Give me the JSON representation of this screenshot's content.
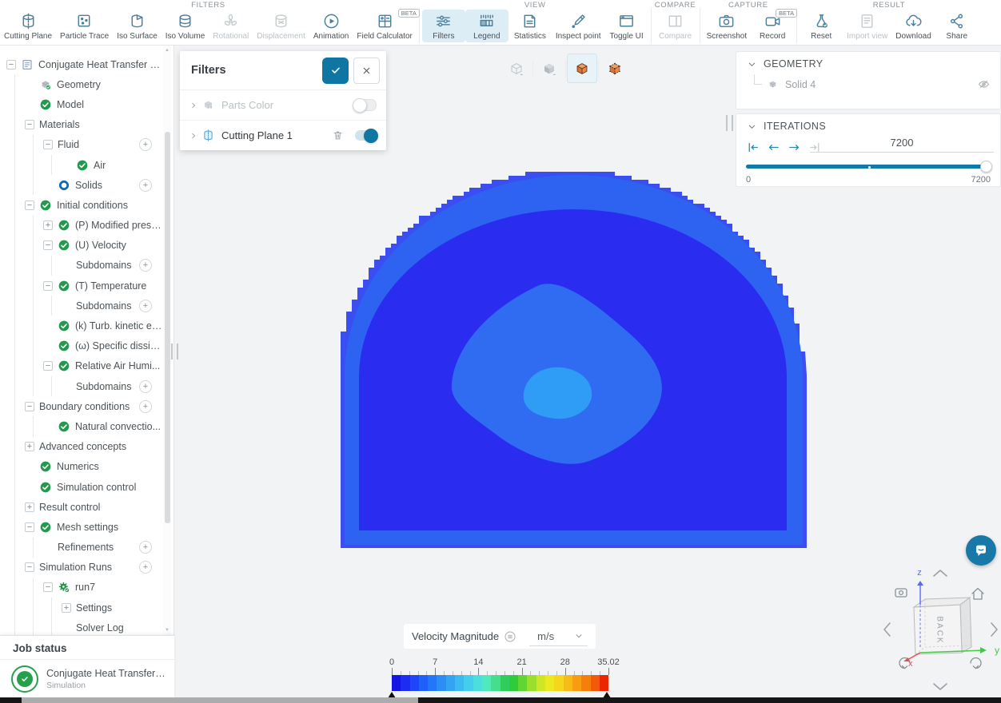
{
  "toolbar": {
    "beta_label": "BETA",
    "groups": [
      {
        "label": "FILTERS",
        "items": [
          {
            "label": "Cutting Plane",
            "icon": "cutting-plane"
          },
          {
            "label": "Particle Trace",
            "icon": "particle-trace"
          },
          {
            "label": "Iso Surface",
            "icon": "iso-surface"
          },
          {
            "label": "Iso Volume",
            "icon": "iso-volume"
          },
          {
            "label": "Rotational",
            "icon": "rotational",
            "enabled": false
          },
          {
            "label": "Displacement",
            "icon": "displacement",
            "enabled": false
          },
          {
            "label": "Animation",
            "icon": "animation"
          },
          {
            "label": "Field Calculator",
            "icon": "field-calculator",
            "beta": true
          }
        ]
      },
      {
        "label": "VIEW",
        "items": [
          {
            "label": "Filters",
            "icon": "filters",
            "active": true
          },
          {
            "label": "Legend",
            "icon": "legend",
            "active": true
          },
          {
            "label": "Statistics",
            "icon": "statistics"
          },
          {
            "label": "Inspect point",
            "icon": "inspect-point"
          },
          {
            "label": "Toggle UI",
            "icon": "toggle-ui"
          }
        ]
      },
      {
        "label": "COMPARE",
        "items": [
          {
            "label": "Compare",
            "icon": "compare",
            "enabled": false
          }
        ]
      },
      {
        "label": "CAPTURE",
        "items": [
          {
            "label": "Screenshot",
            "icon": "screenshot"
          },
          {
            "label": "Record",
            "icon": "record",
            "beta": true
          }
        ]
      },
      {
        "label": "RESULT",
        "items": [
          {
            "label": "Reset",
            "icon": "reset"
          },
          {
            "label": "Import view",
            "icon": "import-view",
            "enabled": false
          },
          {
            "label": "Download",
            "icon": "download"
          },
          {
            "label": "Share",
            "icon": "share"
          }
        ]
      }
    ]
  },
  "tree": {
    "rows": [
      {
        "label": "Conjugate Heat Transfer (I...",
        "level": 0,
        "expander": "-",
        "icon": "doc"
      },
      {
        "label": "Geometry",
        "level": 1,
        "icon": "part"
      },
      {
        "label": "Model",
        "level": 1,
        "icon": "check"
      },
      {
        "label": "Materials",
        "level": 1,
        "expander": "-"
      },
      {
        "label": "Fluid",
        "level": 2,
        "expander": "-",
        "add_button": true
      },
      {
        "label": "Air",
        "level": 3,
        "icon": "check"
      },
      {
        "label": "Solids",
        "level": 2,
        "icon": "ring",
        "add_button": true
      },
      {
        "label": "Initial conditions",
        "level": 1,
        "expander": "-",
        "icon": "check"
      },
      {
        "label": "(P) Modified press...",
        "level": 2,
        "expander": "+",
        "icon": "check"
      },
      {
        "label": "(U) Velocity",
        "level": 2,
        "expander": "-",
        "icon": "check"
      },
      {
        "label": "Subdomains",
        "level": 3,
        "add_button": true
      },
      {
        "label": "(T) Temperature",
        "level": 2,
        "expander": "-",
        "icon": "check"
      },
      {
        "label": "Subdomains",
        "level": 3,
        "add_button": true
      },
      {
        "label": "(k) Turb. kinetic en...",
        "level": 2,
        "icon": "check"
      },
      {
        "label": "(ω) Specific dissipa...",
        "level": 2,
        "icon": "check"
      },
      {
        "label": "Relative Air Humi...",
        "level": 2,
        "expander": "-",
        "icon": "check"
      },
      {
        "label": "Subdomains",
        "level": 3,
        "add_button": true
      },
      {
        "label": "Boundary conditions",
        "level": 1,
        "expander": "-",
        "add_button": true
      },
      {
        "label": "Natural convectio...",
        "level": 2,
        "icon": "check"
      },
      {
        "label": "Advanced concepts",
        "level": 1,
        "expander": "+"
      },
      {
        "label": "Numerics",
        "level": 1,
        "icon": "check"
      },
      {
        "label": "Simulation control",
        "level": 1,
        "icon": "check"
      },
      {
        "label": "Result control",
        "level": 1,
        "expander": "+"
      },
      {
        "label": "Mesh settings",
        "level": 1,
        "expander": "-",
        "icon": "check"
      },
      {
        "label": "Refinements",
        "level": 2,
        "add_button": true
      },
      {
        "label": "Simulation Runs",
        "level": 1,
        "expander": "-",
        "add_button": true
      },
      {
        "label": "run7",
        "level": 2,
        "expander": "-",
        "icon": "gear"
      },
      {
        "label": "Settings",
        "level": 3,
        "expander": "+"
      },
      {
        "label": "Solver Log",
        "level": 3
      }
    ]
  },
  "job_status": {
    "title": "Job status",
    "name": "Conjugate Heat Transfer (IB...",
    "type": "Simulation"
  },
  "filters_panel": {
    "title": "Filters",
    "rows": [
      {
        "label": "Parts Color",
        "icon": "part-gray",
        "enabled": false,
        "toggle_on": false,
        "deletable": false
      },
      {
        "label": "Cutting Plane 1",
        "icon": "cutting-plane-blue",
        "enabled": true,
        "toggle_on": true,
        "deletable": true
      }
    ]
  },
  "view_modes": [
    {
      "name": "wireframe",
      "active": false
    },
    {
      "name": "surface",
      "active": false
    },
    {
      "name": "surface-solid",
      "active": true
    },
    {
      "name": "solid-wireframe",
      "active": false
    }
  ],
  "right_panel": {
    "geometry": {
      "title": "GEOMETRY",
      "item": "Solid 4"
    },
    "iterations": {
      "title": "ITERATIONS",
      "value": "7200",
      "min": "0",
      "max": "7200",
      "controls": {
        "skip_start_enabled": true,
        "prev_enabled": true,
        "next_enabled": true,
        "skip_end_enabled": false
      },
      "slider_fraction": 1.0,
      "marker_fraction": 0.5
    }
  },
  "legend": {
    "field": "Velocity Magnitude",
    "unit": "m/s",
    "tick_labels": [
      "0",
      "7",
      "14",
      "21",
      "28",
      "35.02"
    ],
    "range": [
      0,
      35.02
    ],
    "colors": [
      "#1414e4",
      "#1c2cf2",
      "#1f45f8",
      "#1f5ffa",
      "#2277f8",
      "#2b8ef4",
      "#34a4f2",
      "#3cb9f0",
      "#44cdec",
      "#4adfdc",
      "#50e9bd",
      "#46dd8d",
      "#31cd5c",
      "#2ecb3b",
      "#63d532",
      "#9bdf2b",
      "#cde726",
      "#ece921",
      "#f6d51d",
      "#f8ba17",
      "#f89d12",
      "#f67e0d",
      "#f25a07",
      "#ea2603"
    ]
  },
  "viz": {
    "field": "Velocity Magnitude contour slice",
    "colors": {
      "edge": "#3a4ef2",
      "ring": "#2e63f2",
      "body": "#2a2df0",
      "contour": "#2f6cf2",
      "core": "#2f9df5"
    }
  },
  "nav_cube": {
    "face_label": "BACK",
    "axes": [
      "x",
      "y",
      "z"
    ],
    "axis_colors": {
      "x": "#e05252",
      "y": "#46c846",
      "z": "#5b6bec"
    }
  },
  "theme": {
    "accent_teal": "#0f7ba6",
    "success_green": "#27a04c",
    "icon_blue": "#4a7f9c",
    "canvas_bg": "#f2f3f5"
  }
}
